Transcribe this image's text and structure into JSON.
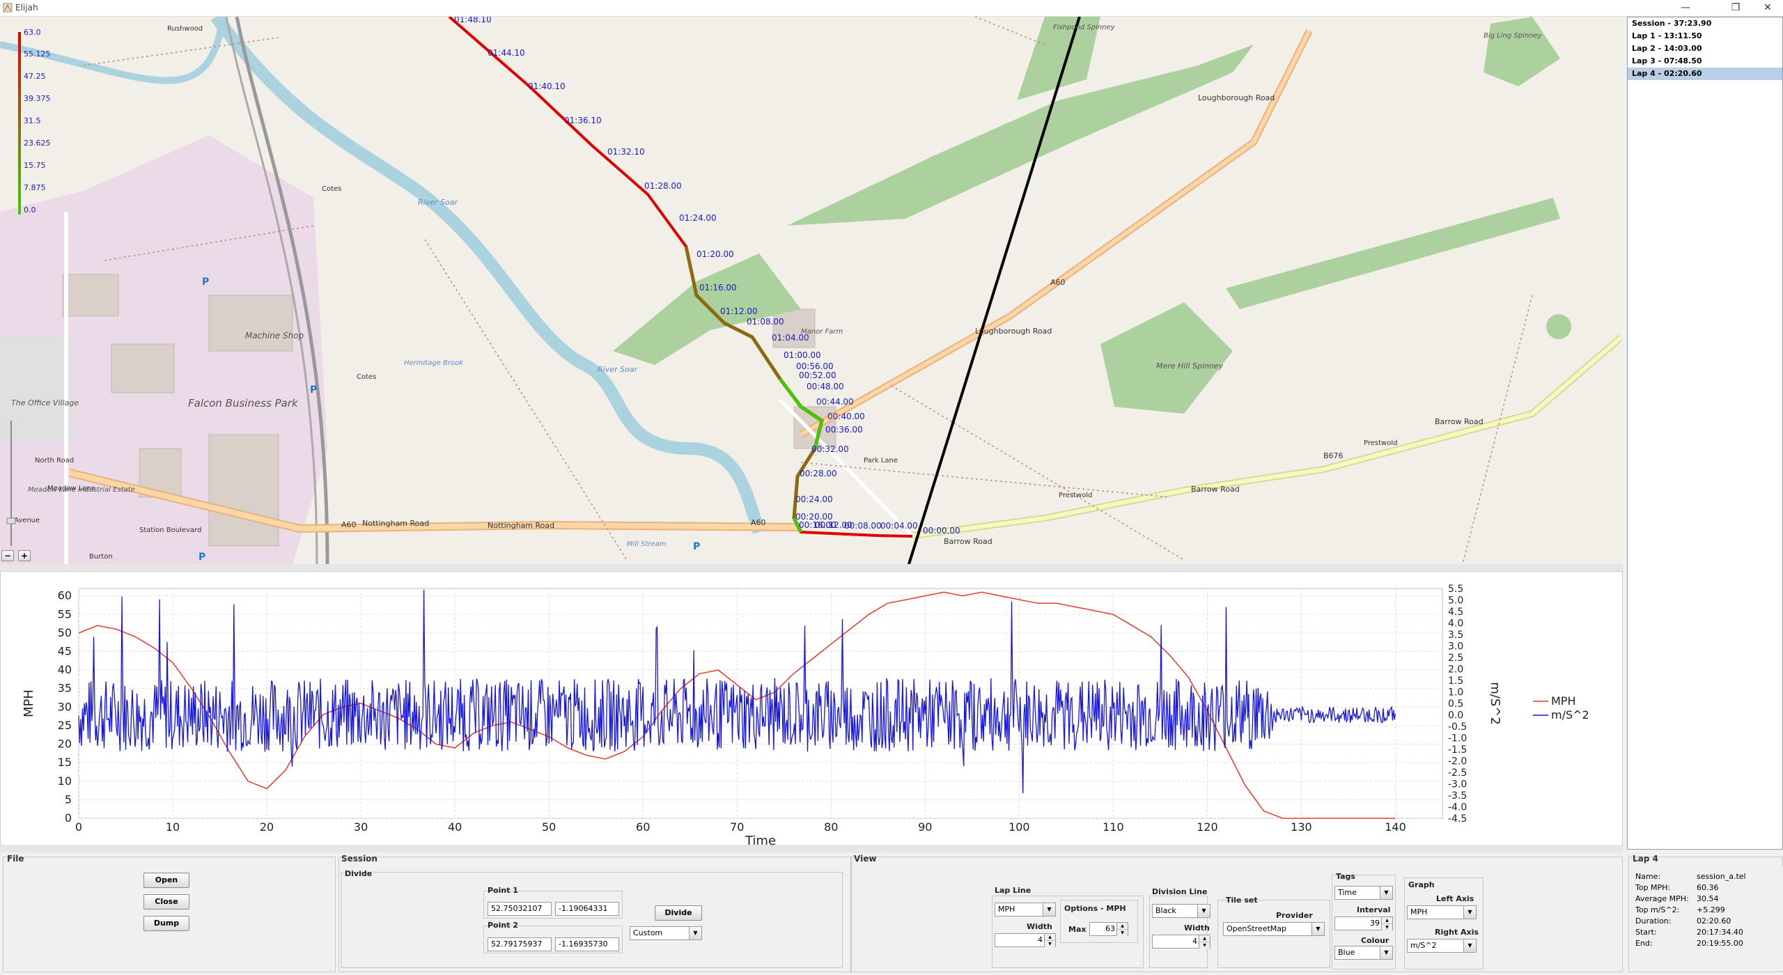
{
  "window": {
    "title": "Elijah",
    "minimize": "—",
    "restore": "❐",
    "close": "✕"
  },
  "map": {
    "speed_legend": [
      "63.0",
      "55.125",
      "47.25",
      "39.375",
      "31.5",
      "23.625",
      "15.75",
      "7.875",
      "0.0"
    ],
    "zoom_in": "+",
    "zoom_out": "−",
    "track_times": [
      "01:48.10",
      "01:44.10",
      "01:40.10",
      "01:36.10",
      "01:32.10",
      "01:28.00",
      "01:24.00",
      "01:20.00",
      "01:16.00",
      "01:12.00",
      "01:08.00",
      "01:04.00",
      "01:00.00",
      "00:56.00",
      "00:52.00",
      "00:48.00",
      "00:44.00",
      "00:40.00",
      "00:36.00",
      "00:32.00",
      "00:28.00",
      "00:24.00",
      "00:20.00",
      "00:16.00",
      "00:12.00",
      "00:08.00",
      "00:04.00",
      "00:00.00"
    ],
    "place_labels": {
      "falcon": "Falcon Business Park",
      "machine_shop": "Machine Shop",
      "office_village": "The Office Village",
      "meadow_lane_estate": "Meadow Lane Industrial Estate",
      "mere_hill": "Mere Hill Spinney",
      "big_ling": "Big Ling Spinney",
      "fishpond": "Fishpond Spinney",
      "manor": "Manor Farm",
      "meadow_lane": "Meadow Lane",
      "north_road": "North Road",
      "station_boulevard": "Station Boulevard",
      "burton": "Burton",
      "nottingham_road": "Nottingham Road",
      "nottingham_road_b": "Nottingham Road",
      "loughborough_road": "Loughborough Road",
      "loughborough_road_b": "Loughborough Road",
      "a60": "A60",
      "a60_b": "A60",
      "a60_c": "A60",
      "b676": "B676",
      "barrow_road": "Barrow Road",
      "barrow_road_b": "Barrow Road",
      "barrow_road_c": "Barrow Road",
      "prestwold": "Prestwold",
      "prestwold_b": "Prestwold",
      "river_soar": "River Soar",
      "river_soar_b": "River Soar",
      "hermitage_brook": "Hermitage Brook",
      "park_lane": "Park Lane",
      "mill_stream": "Mill Stream",
      "cotes": "Cotes",
      "cotes_b": "Cotes",
      "rushwood": "Rushwood",
      "avenue": "Avenue"
    }
  },
  "chart_data": {
    "type": "line",
    "title": "",
    "xlabel": "Time",
    "ylabel_left": "MPH",
    "ylabel_right": "m/S^2",
    "xlim": [
      0,
      145
    ],
    "x_ticks": [
      0,
      10,
      20,
      30,
      40,
      50,
      60,
      70,
      80,
      90,
      100,
      110,
      120,
      130,
      140
    ],
    "ylim_left": [
      0,
      62
    ],
    "y_ticks_left": [
      0,
      5,
      10,
      15,
      20,
      25,
      30,
      35,
      40,
      45,
      50,
      55,
      60
    ],
    "ylim_right": [
      -4.5,
      5.5
    ],
    "y_ticks_right": [
      -4.5,
      -4.0,
      -3.5,
      -3.0,
      -2.5,
      -2.0,
      -1.5,
      -1.0,
      -0.5,
      0.0,
      0.5,
      1.0,
      1.5,
      2.0,
      2.5,
      3.0,
      3.5,
      4.0,
      4.5,
      5.0,
      5.5
    ],
    "grid": true,
    "legend": "right",
    "series": [
      {
        "name": "MPH",
        "axis": "left",
        "color": "#e8392b",
        "x": [
          0,
          2,
          4,
          6,
          8,
          10,
          12,
          14,
          16,
          18,
          20,
          22,
          24,
          26,
          28,
          30,
          32,
          34,
          36,
          38,
          40,
          42,
          44,
          46,
          48,
          50,
          52,
          54,
          56,
          58,
          60,
          62,
          64,
          66,
          68,
          70,
          72,
          74,
          76,
          78,
          80,
          82,
          84,
          86,
          88,
          90,
          92,
          94,
          96,
          98,
          100,
          102,
          104,
          106,
          108,
          110,
          112,
          114,
          116,
          118,
          120,
          122,
          124,
          126,
          128,
          130,
          132,
          134,
          136,
          138,
          140
        ],
        "y": [
          50,
          52,
          51,
          49,
          46,
          42,
          35,
          27,
          18,
          10,
          8,
          13,
          22,
          28,
          30,
          31,
          29,
          27,
          24,
          20,
          19,
          23,
          25,
          26,
          24,
          22,
          19,
          17,
          16,
          18,
          22,
          29,
          35,
          39,
          40,
          36,
          32,
          34,
          39,
          43,
          47,
          51,
          55,
          58,
          59,
          60,
          61,
          60,
          61,
          60,
          59,
          58,
          58,
          57,
          56,
          55,
          52,
          49,
          44,
          38,
          29,
          19,
          9,
          2,
          0,
          0,
          0,
          0,
          0,
          0,
          0
        ]
      },
      {
        "name": "m/S^2",
        "axis": "right",
        "color": "#1515e6",
        "amplitude_max": 5.5,
        "amplitude_min": -4.4
      }
    ]
  },
  "laps": [
    {
      "label": "Session - 37:23.90",
      "selected": false
    },
    {
      "label": "Lap 1 - 13:11.50",
      "selected": false
    },
    {
      "label": "Lap 2 - 14:03.00",
      "selected": false
    },
    {
      "label": "Lap 3 - 07:48.50",
      "selected": false
    },
    {
      "label": "Lap 4 - 02:20.60",
      "selected": true
    }
  ],
  "file_panel": {
    "title": "File",
    "open": "Open",
    "close": "Close",
    "dump": "Dump"
  },
  "session_panel": {
    "title": "Session",
    "divide_title": "Divide",
    "point1_label": "Point 1",
    "point1_lat": "52.75032107",
    "point1_lon": "-1.19064331",
    "point2_label": "Point 2",
    "point2_lat": "52.79175937",
    "point2_lon": "-1.16935730",
    "divide_button": "Divide",
    "mode": "Custom"
  },
  "view_panel": {
    "title": "View",
    "lap_line_label": "Lap Line",
    "lap_line_unit": "MPH",
    "width_label": "Width",
    "lap_line_width": "4",
    "options_label": "Options - MPH",
    "max_label": "Max",
    "max_value": "63",
    "division_line_label": "Division Line",
    "division_colour": "Black",
    "division_width_label": "Width",
    "division_width": "4",
    "tile_set_label": "Tile set",
    "provider_label": "Provider",
    "provider": "OpenStreetMap",
    "tags_label": "Tags",
    "tags_mode": "Time",
    "interval_label": "Interval",
    "interval": "39",
    "colour_label": "Colour",
    "colour": "Blue",
    "graph_label": "Graph",
    "left_axis_label": "Left Axis",
    "left_axis": "MPH",
    "right_axis_label": "Right Axis",
    "right_axis": "m/S^2"
  },
  "lap_info": {
    "title": "Lap 4",
    "rows": [
      {
        "key": "Name:",
        "value": "session_a.tel"
      },
      {
        "key": "Top MPH:",
        "value": "60.36"
      },
      {
        "key": "Average MPH:",
        "value": "30.54"
      },
      {
        "key": "Top m/S^2:",
        "value": "+5.299"
      },
      {
        "key": "Duration:",
        "value": "02:20.60"
      },
      {
        "key": "Start:",
        "value": "20:17:34.40"
      },
      {
        "key": "End:",
        "value": "20:19:55.00"
      }
    ]
  }
}
